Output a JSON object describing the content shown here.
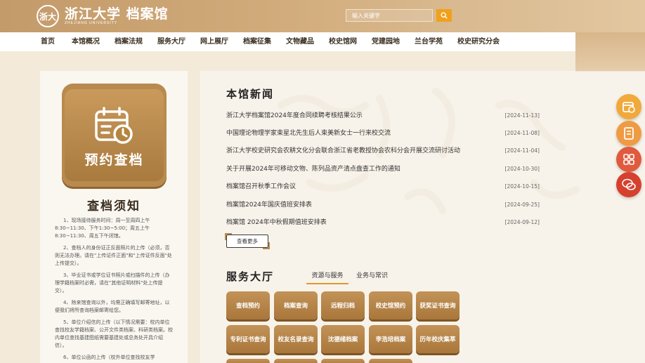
{
  "header": {
    "logo_seal": "浙大",
    "logo_main": "浙江大学 档案馆",
    "logo_sub": "ZHEJIANG UNIVERSITY",
    "search_placeholder": "输入关键字"
  },
  "nav": {
    "items": [
      "首页",
      "本馆概况",
      "档案法规",
      "服务大厅",
      "网上展厅",
      "档案征集",
      "文物藏品",
      "校史馆网",
      "党建园地",
      "兰台学苑",
      "校史研究分会"
    ]
  },
  "left": {
    "card_label": "预约查档",
    "notice_title": "查档须知",
    "notices": [
      "1、现场接待服务时间：周一至周四上午8:30~11:30、下午1:30~5:00；周五上午8:30~11:30、周五下午闭馆。",
      "2、查档人的身份证正反面照片的上传（必须，否则无法办理。请在\"上传证件正面\"和\"上传证件反面\"处上传提交）。",
      "3、毕业证书或学位证书照片或扫描件的上传（办理学籍档案时必需，请在\"其他证明材料\"处上传提交）。",
      "4、除来馆查询以外，均需正确填写邮寄地址，以便我们将所查询档案邮寄给您。",
      "5、单位介绍信的上传（以下情况需要：校内单位查找校友学籍档案、公开文件类档案、科研类档案。校内单位查找基建图纸需要基建处或总务处开具介绍信）。",
      "6、单位公函的上传（校外单位查找校友学"
    ]
  },
  "news": {
    "title": "本馆新闻",
    "items": [
      {
        "title": "浙江大学档案馆2024年度合同续聘考核结果公示",
        "date": "[2024-11-13]"
      },
      {
        "title": "中国理论物理学家束星北先生后人束美新女士一行来校交流",
        "date": "[2024-11-08]"
      },
      {
        "title": "浙江大学校史研究会农耕文化分会联合浙江省老教授协会农科分会开展交流研讨活动",
        "date": "[2024-11-04]"
      },
      {
        "title": "关于开展2024年可移动文物、陈列品资产清点盘查工作的通知",
        "date": "[2024-10-30]"
      },
      {
        "title": "档案馆召开秋季工作会议",
        "date": "[2024-10-15]"
      },
      {
        "title": "档案馆2024年国庆值班安排表",
        "date": "[2024-09-25]"
      },
      {
        "title": "档案馆 2024年中秋假期值班安排表",
        "date": "[2024-09-12]"
      }
    ],
    "more_label": "查看更多"
  },
  "services": {
    "title": "服务大厅",
    "tabs": [
      "资源与服务",
      "业务与常识"
    ],
    "row1": [
      "查档预约",
      "档案查询",
      "远程归档",
      "校史馆预约",
      "获奖证书查询"
    ],
    "row2": [
      "专利证书查询",
      "校友名录查询",
      "沈德绪档案",
      "李浩培档案",
      "历年校庆集萃"
    ]
  },
  "colors": {
    "accent": "#b98a4e",
    "search_button": "#f0a11c",
    "float_orange": "#f0a93a",
    "float_red": "#e05a3e"
  }
}
